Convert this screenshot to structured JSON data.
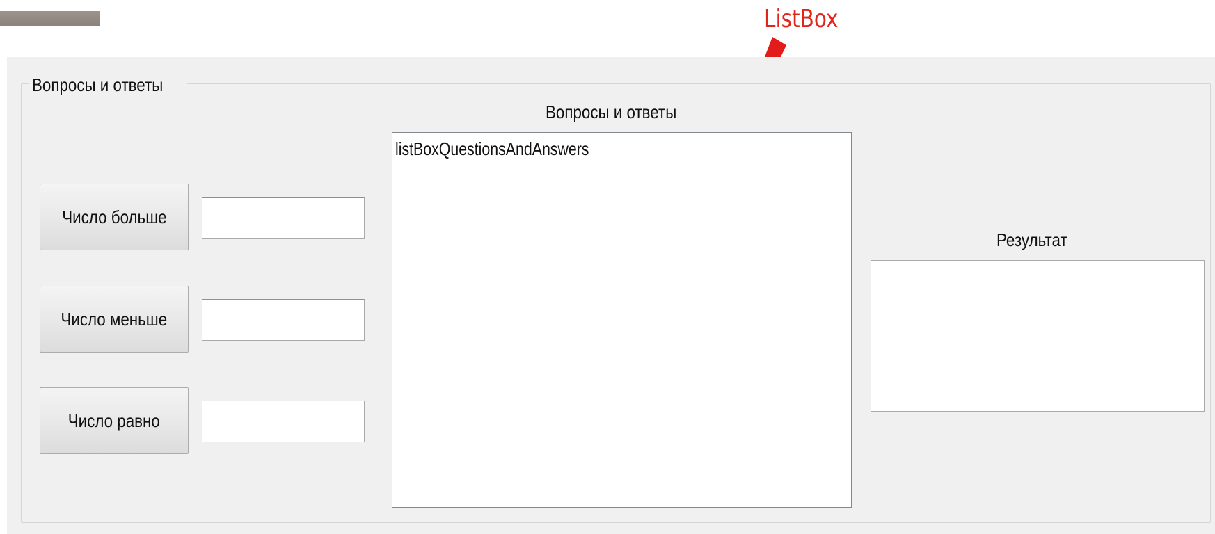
{
  "annotation": {
    "label": "ListBox",
    "color": "#e0261c",
    "icon": "red-arrow-icon"
  },
  "groupbox": {
    "caption": "Вопросы и ответы"
  },
  "buttons": {
    "greater_label": "Число больше",
    "less_label": "Число меньше",
    "equal_label": "Число равно"
  },
  "inputs": {
    "greater_value": "",
    "less_value": "",
    "equal_value": ""
  },
  "listbox": {
    "label": "Вопросы и ответы",
    "items": [
      "listBoxQuestionsAndAnswers"
    ]
  },
  "result": {
    "label": "Результат",
    "value": ""
  }
}
